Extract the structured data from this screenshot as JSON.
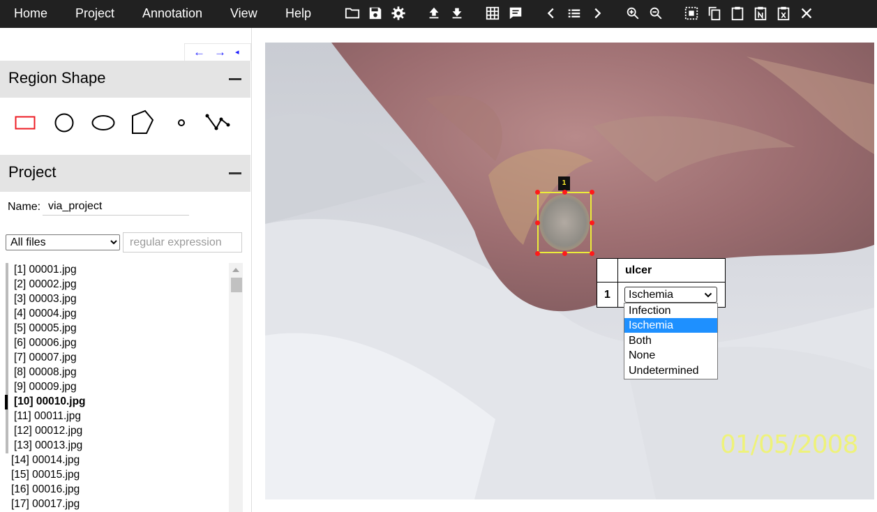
{
  "menu": {
    "items": [
      "Home",
      "Project",
      "Annotation",
      "View",
      "Help"
    ]
  },
  "toolbar": {
    "icons": [
      "folder-open-icon",
      "save-icon",
      "settings-icon",
      "upload-icon",
      "download-icon",
      "grid-icon",
      "comment-icon",
      "chevron-left-icon",
      "list-icon",
      "chevron-right-icon",
      "zoom-in-icon",
      "zoom-out-icon",
      "select-all-icon",
      "copy-icon",
      "paste-icon",
      "paste-n-icon",
      "delete-region-icon",
      "close-icon"
    ]
  },
  "panel_nav": {
    "prev": "←",
    "next": "→",
    "collapse": "◂"
  },
  "region_shape": {
    "title": "Region Shape",
    "toggle": "minus-icon",
    "shapes": [
      "rectangle",
      "circle",
      "ellipse",
      "polygon",
      "point",
      "polyline"
    ],
    "selected": "rectangle",
    "selected_color": "#ed1c24"
  },
  "project": {
    "title": "Project",
    "name_label": "Name:",
    "name_value": "via_project",
    "filter_selected": "All files",
    "regex_placeholder": "regular expression",
    "files": [
      "[1] 00001.jpg",
      "[2] 00002.jpg",
      "[3] 00003.jpg",
      "[4] 00004.jpg",
      "[5] 00005.jpg",
      "[6] 00006.jpg",
      "[7] 00007.jpg",
      "[8] 00008.jpg",
      "[9] 00009.jpg",
      "[10] 00010.jpg",
      "[11] 00011.jpg",
      "[12] 00012.jpg",
      "[13] 00013.jpg",
      "[14] 00014.jpg",
      "[15] 00015.jpg",
      "[16] 00016.jpg",
      "[17] 00017.jpg"
    ],
    "active_index": 9
  },
  "canvas": {
    "region_id": "1",
    "region_color": "#ecec3a",
    "date_stamp": "01/05/2008"
  },
  "annotation": {
    "attribute": "ulcer",
    "row_id": "1",
    "selected": "Ischemia",
    "options": [
      "Infection",
      "Ischemia",
      "Both",
      "None",
      "Undetermined"
    ],
    "highlight_color": "#1e90ff"
  }
}
